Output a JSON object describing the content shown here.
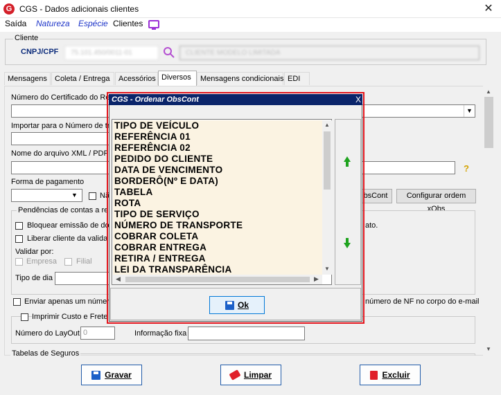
{
  "window": {
    "title": "CGS - Dados adicionais clientes",
    "icon": "cgs-logo-icon",
    "icon_text": "G"
  },
  "menu": {
    "items": [
      "Saída",
      "Natureza",
      "Espécie",
      "Clientes"
    ],
    "monitor_icon": "monitor-icon"
  },
  "cliente": {
    "group_label": "Cliente",
    "cnpj_label": "CNPJ/CPF",
    "cnpj_value": "75.101.450/0011-01",
    "name_value": "CLIENTE MODELO LIMITADA"
  },
  "tabs": [
    "Mensagens",
    "Coleta / Entrega",
    "Acessórios",
    "Diversos",
    "Mensagens condicionais",
    "EDI"
  ],
  "active_tab": "Diversos",
  "diversos": {
    "numero_certificado_label": "Número do Certificado do Re",
    "importar_label": "Importar para o Número de tra",
    "nome_arquivo_label": "Nome do arquivo XML / PDF",
    "forma_pagamento_label": "Forma de pagamento",
    "nao_label": "Nã",
    "obscont_button": "bsCont",
    "configurar_button": "Configurar ordem xObs",
    "pendencias_label": "Pendências de contas a re",
    "bloquear_label": "Bloquear emissão de doc",
    "liberar_label": "Liberar cliente da valida",
    "right_text_1": "ato.",
    "validar_label": "Validar por:",
    "empresa_label": "Empresa",
    "filial_label": "Filial",
    "tipo_dia_label": "Tipo de dia",
    "enviar_label": "Enviar apenas um número",
    "right_text_2": "número de NF no corpo do e-mail",
    "imprimir_label": "Imprimir Custo e Frete p",
    "layout_label": "Número do LayOut",
    "layout_value": "0",
    "informacao_label": "Informação fixa",
    "tabelas_label": "Tabelas de Seguros"
  },
  "buttons": {
    "gravar": "Gravar",
    "limpar": "Limpar",
    "excluir": "Excluir"
  },
  "dialog": {
    "title": "CGS - Ordenar ObsCont",
    "close": "X",
    "items": [
      "TIPO DE VEÍCULO",
      "REFERÊNCIA 01",
      "REFERÊNCIA 02",
      "PEDIDO DO CLIENTE",
      "DATA DE VENCIMENTO",
      "BORDERÔ(Nº E DATA)",
      "TABELA",
      "ROTA",
      "TIPO DE SERVIÇO",
      "NÚMERO DE TRANSPORTE",
      "COBRAR COLETA",
      "COBRAR ENTREGA",
      "RETIRA / ENTREGA",
      "LEI DA TRANSPARÊNCIA"
    ],
    "ok_label": "Ok",
    "move_up_icon": "arrow-up-icon",
    "move_down_icon": "arrow-down-icon"
  }
}
